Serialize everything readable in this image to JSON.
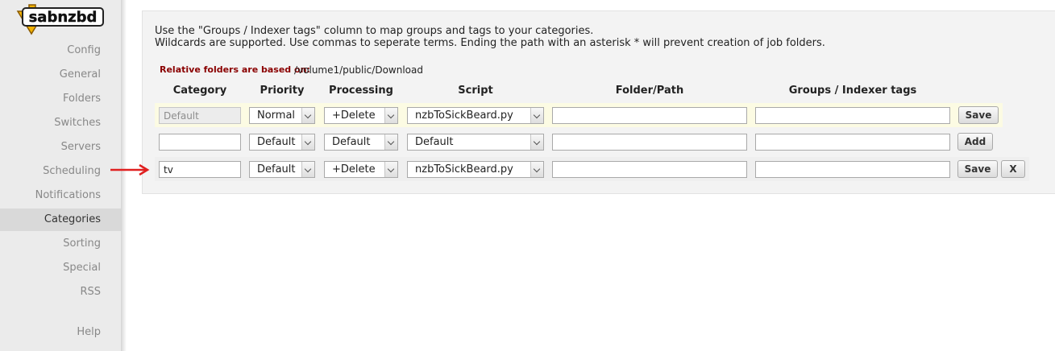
{
  "app": {
    "logo_text": "sabnzbd"
  },
  "sidebar": {
    "items": [
      {
        "label": "Config"
      },
      {
        "label": "General"
      },
      {
        "label": "Folders"
      },
      {
        "label": "Switches"
      },
      {
        "label": "Servers"
      },
      {
        "label": "Scheduling"
      },
      {
        "label": "Notifications"
      },
      {
        "label": "Categories",
        "active": true
      },
      {
        "label": "Sorting"
      },
      {
        "label": "Special"
      },
      {
        "label": "RSS"
      },
      {
        "label": "Help"
      }
    ]
  },
  "intro": {
    "line1": "Use the \"Groups / Indexer tags\" column to map groups and tags to your categories.",
    "line2": "Wildcards are supported. Use commas to seperate terms. Ending the path with an asterisk * will prevent creation of job folders."
  },
  "relative_folders": {
    "label": "Relative folders are based on:",
    "path": "/volume1/public/Download"
  },
  "table": {
    "headers": {
      "category": "Category",
      "priority": "Priority",
      "processing": "Processing",
      "script": "Script",
      "folder": "Folder/Path",
      "groups": "Groups / Indexer tags"
    },
    "rows": [
      {
        "category": "Default",
        "category_disabled": true,
        "priority": "Normal",
        "processing": "+Delete",
        "script": "nzbToSickBeard.py",
        "folder": "",
        "groups": "",
        "action": "Save"
      },
      {
        "category": "",
        "priority": "Default",
        "processing": "Default",
        "script": "Default",
        "folder": "",
        "groups": "",
        "action": "Add"
      },
      {
        "category": "tv",
        "priority": "Default",
        "processing": "+Delete",
        "script": "nzbToSickBeard.py",
        "folder": "",
        "groups": "",
        "action": "Save",
        "delete": "X"
      }
    ]
  },
  "colors": {
    "sidebar_bg": "#ebebeb",
    "active_item_bg": "#d9d9d9",
    "panel_bg": "#f3f3f3",
    "highlight_row_bg": "#fcfbe3",
    "relative_label": "#8a0000",
    "annotation_arrow": "#e02020"
  },
  "icons": {
    "logo": "sabnzbd-download-logo",
    "select_arrow": "chevron-down-icon",
    "annotation": "red-arrow-icon"
  }
}
